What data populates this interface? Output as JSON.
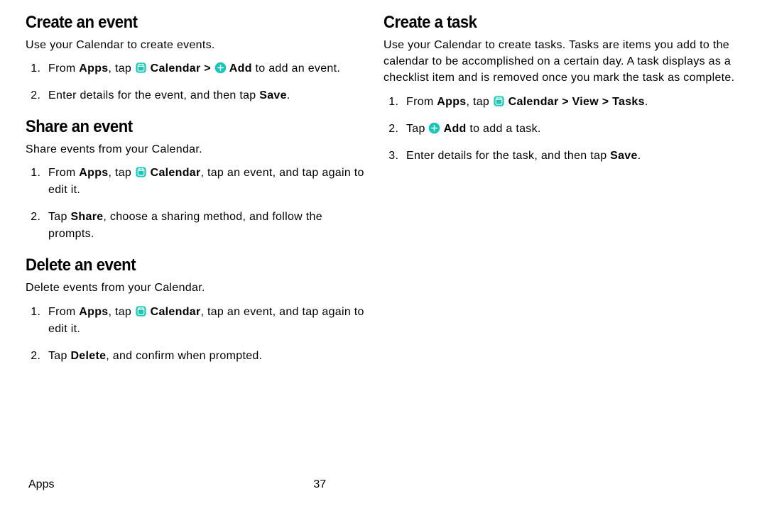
{
  "left": {
    "sec1": {
      "heading": "Create an event",
      "intro": "Use your Calendar to create events.",
      "step1_pre": "From ",
      "step1_apps": "Apps",
      "step1_mid": ", tap ",
      "step1_calendar": " Calendar > ",
      "step1_add": " Add",
      "step1_post": " to add an event.",
      "step2_pre": "Enter details for the event, and then tap ",
      "step2_save": "Save",
      "step2_post": "."
    },
    "sec2": {
      "heading": "Share an event",
      "intro": "Share events from your Calendar.",
      "step1_pre": "From ",
      "step1_apps": "Apps",
      "step1_mid": ", tap ",
      "step1_calendar": " Calendar",
      "step1_post": ", tap an event, and tap again to edit it.",
      "step2_pre": "Tap ",
      "step2_share": "Share",
      "step2_post": ", choose a sharing method, and follow the prompts."
    },
    "sec3": {
      "heading": "Delete an event",
      "intro": "Delete events from your Calendar.",
      "step1_pre": "From ",
      "step1_apps": "Apps",
      "step1_mid": ", tap ",
      "step1_calendar": " Calendar",
      "step1_post": ", tap an event, and tap again to edit it.",
      "step2_pre": "Tap ",
      "step2_delete": "Delete",
      "step2_post": ", and confirm when prompted."
    }
  },
  "right": {
    "sec1": {
      "heading": "Create a task",
      "intro": "Use your Calendar to create tasks. Tasks are items you add to the calendar to be accomplished on a certain day. A task displays as a checklist item and is removed once you mark the task as complete.",
      "step1_pre": "From ",
      "step1_apps": "Apps",
      "step1_mid": ", tap ",
      "step1_calendar": " Calendar > View > Tasks",
      "step1_post": ".",
      "step2_pre": "Tap ",
      "step2_add": " Add",
      "step2_post": " to add a task.",
      "step3_pre": "Enter details for the task, and then tap ",
      "step3_save": "Save",
      "step3_post": "."
    }
  },
  "footer": {
    "section": "Apps",
    "page": "37"
  },
  "colors": {
    "accent": "#19c7b8"
  }
}
